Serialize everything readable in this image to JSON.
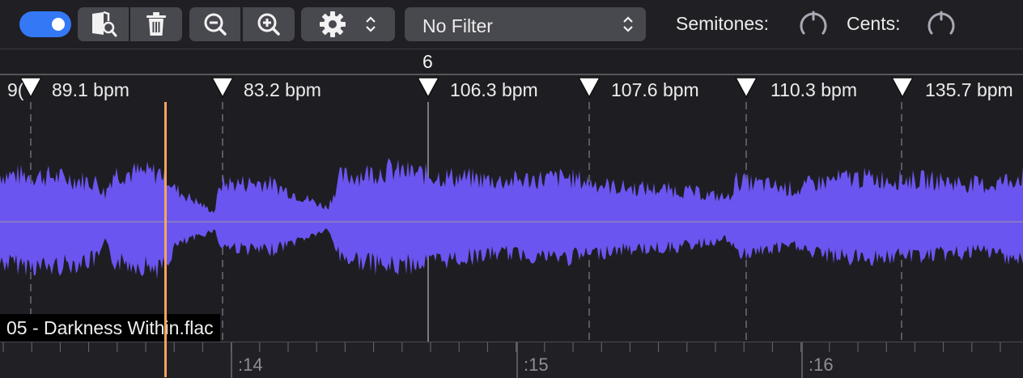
{
  "toolbar": {
    "filter": {
      "value": "No Filter"
    },
    "semitones_label": "Semitones:",
    "cents_label": "Cents:",
    "icons": {
      "browse": "folder-search-icon",
      "delete": "trash-icon",
      "zoom_out": "zoom-out-icon",
      "zoom_in": "zoom-in-icon",
      "settings": "gear-icon"
    }
  },
  "timeline": {
    "bar_number": "6",
    "bpm_markers": [
      {
        "label": "9("
      },
      {
        "label": "89.1 bpm"
      },
      {
        "label": "83.2 bpm"
      },
      {
        "label": "106.3 bpm"
      },
      {
        "label": "107.6 bpm"
      },
      {
        "label": "110.3 bpm"
      },
      {
        "label": "135.7 bpm"
      }
    ],
    "time_labels": [
      ":14",
      ":15",
      ":16"
    ]
  },
  "track": {
    "file_name": "05 - Darkness Within.flac",
    "waveform_color": "#6b55f0",
    "playhead_color": "#f5a65b"
  },
  "colors": {
    "accent": "#3478f6",
    "button": "#48484f",
    "background": "#1e1e22"
  }
}
